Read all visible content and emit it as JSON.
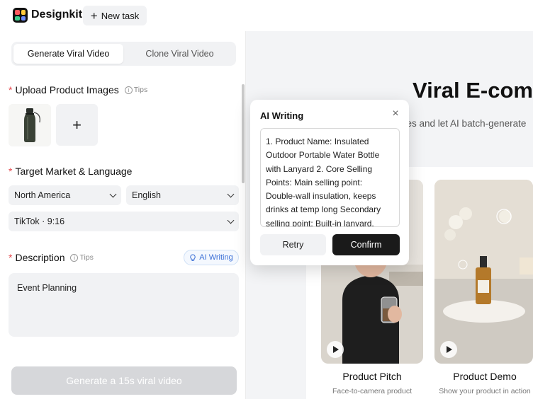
{
  "app": {
    "brand": "Designkit",
    "new_task_label": "New task",
    "accent": "#3b6fd6"
  },
  "tabs": [
    {
      "label": "Generate Viral Video",
      "active": true
    },
    {
      "label": "Clone Viral Video",
      "active": false
    }
  ],
  "upload": {
    "label": "Upload Product Images",
    "tips": "Tips",
    "add_symbol": "+"
  },
  "market": {
    "label": "Target Market & Language",
    "region": "North America",
    "language": "English",
    "platform": "TikTok · 9:16"
  },
  "description": {
    "label": "Description",
    "tips": "Tips",
    "ai_writing_label": "AI Writing",
    "value": "Event Planning"
  },
  "generate_label": "Generate a 15s viral video",
  "hero": {
    "title": "Viral E-com",
    "subtitle": "ges and let AI batch-generate"
  },
  "cards": [
    {
      "title": "Product Pitch",
      "subtitle": "Face-to-camera product"
    },
    {
      "title": "Product Demo",
      "subtitle": "Show your product in action"
    }
  ],
  "popup": {
    "title": "AI Writing",
    "close_symbol": "×",
    "text": "1. Product Name: Insulated Outdoor Portable Water Bottle with Lanyard 2. Core Selling Points: Main selling point: Double-wall insulation, keeps drinks at temp long Secondary selling point: Built-in lanyard,",
    "retry_label": "Retry",
    "confirm_label": "Confirm"
  }
}
